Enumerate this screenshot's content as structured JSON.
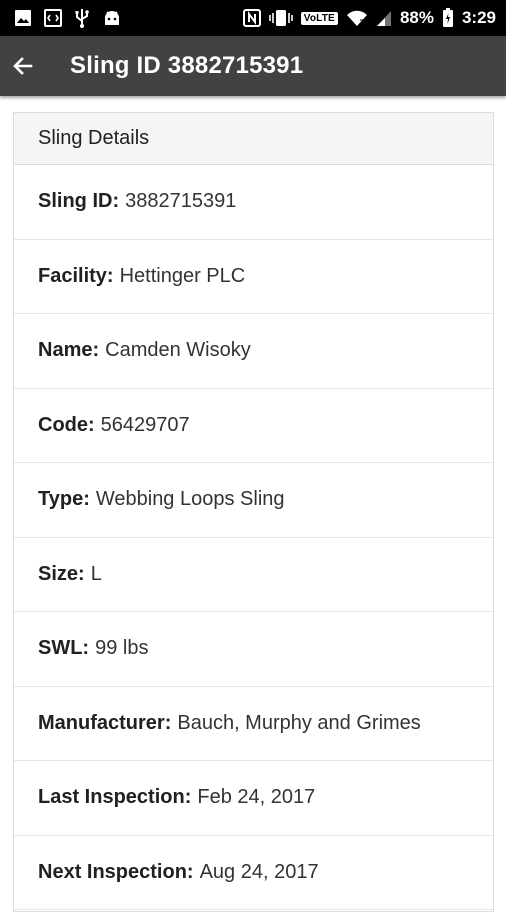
{
  "status_bar": {
    "battery": "88%",
    "time": "3:29",
    "network_badge": "VoLTE",
    "icons_left": [
      "image-icon",
      "code-icon",
      "usb-icon",
      "android-icon"
    ],
    "icons_right": [
      "nfc-icon",
      "vibrate-icon",
      "volte-badge",
      "wifi-icon",
      "signal-icon",
      "battery-icon"
    ]
  },
  "app_bar": {
    "title": "Sling ID 3882715391",
    "back_icon": "arrow-back-icon"
  },
  "card": {
    "header": "Sling Details",
    "rows": [
      {
        "label": "Sling ID:",
        "value": "3882715391"
      },
      {
        "label": "Facility:",
        "value": "Hettinger PLC"
      },
      {
        "label": "Name:",
        "value": "Camden Wisoky"
      },
      {
        "label": "Code:",
        "value": "56429707"
      },
      {
        "label": "Type:",
        "value": "Webbing Loops Sling"
      },
      {
        "label": "Size:",
        "value": "L"
      },
      {
        "label": "SWL:",
        "value": "99 lbs"
      },
      {
        "label": "Manufacturer:",
        "value": "Bauch, Murphy and Grimes"
      },
      {
        "label": "Last Inspection:",
        "value": "Feb 24, 2017"
      },
      {
        "label": "Next Inspection:",
        "value": "Aug 24, 2017"
      }
    ]
  },
  "colors": {
    "status_bar": "#000000",
    "app_bar": "#424242",
    "card_header_bg": "#f5f5f5",
    "border": "#dcdcdc"
  }
}
